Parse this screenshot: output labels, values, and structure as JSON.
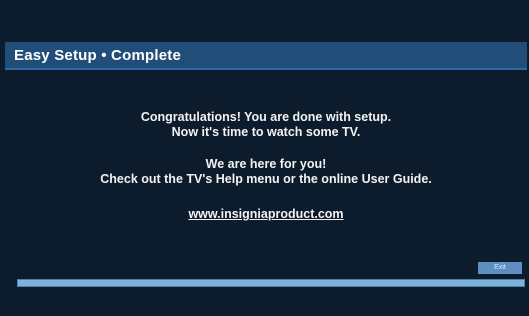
{
  "header": {
    "title": "Easy Setup • Complete"
  },
  "message": {
    "line1": "Congratulations! You are done with setup.",
    "line2": "Now it's time to watch some TV.",
    "line3": "We are here for you!",
    "line4": "Check out the TV's Help menu or the online User Guide.",
    "url": "www.insigniaproduct.com"
  },
  "buttons": {
    "exit_label": "Exit"
  },
  "progress": {
    "percent": 100
  },
  "colors": {
    "background": "#0c1c2c",
    "title_bar": "#214e79",
    "button": "#5d8fc3",
    "progress_fill": "#7fb2d9"
  }
}
